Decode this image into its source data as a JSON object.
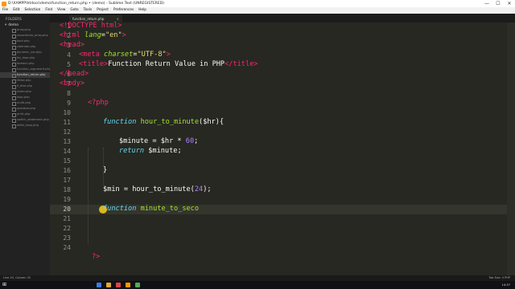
{
  "window": {
    "title": "D:\\XAMPP\\htdocs\\demo\\function_return.php • (demo) - Sublime Text (UNREGISTERED)",
    "controls": [
      "—",
      "☐",
      "✕"
    ]
  },
  "menu": [
    "File",
    "Edit",
    "Selection",
    "Find",
    "View",
    "Goto",
    "Tools",
    "Project",
    "Preferences",
    "Help"
  ],
  "sidebar": {
    "header": "FOLDERS",
    "folder": "demo",
    "files": [
      "array.php",
      "associative_array.php",
      "bool.php",
      "calendar.php",
      "dynamic_var.php",
      "for_loop.php",
      "foreach.php",
      "function_argument.php",
      "function_return.php",
      "ifelse.php",
      "if_else.php",
      "index.php",
      "loop.php",
      "multi.php",
      "operator.php",
      "print.php",
      "switch_statement.php",
      "while_loop.php"
    ],
    "active_index": 8
  },
  "tab": {
    "label": "function_return.php",
    "close": "×"
  },
  "editor": {
    "line_numbers": [
      "1",
      "2",
      "3",
      "4",
      "5",
      "6",
      "7",
      "8",
      "9",
      "10",
      "11",
      "12",
      "13",
      "14",
      "15",
      "16",
      "17",
      "18",
      "19",
      "20",
      "21",
      "22",
      "23",
      "24"
    ],
    "current_line": 20,
    "code": {
      "l1": "<!DOCTYPE html>",
      "l2_tag": "<html",
      "l2_attr": " lang",
      "l2_eq": "=",
      "l2_str": "\"en\"",
      "l2_close": ">",
      "l3": "<head>",
      "l4_tag": "<meta",
      "l4_attr": " charset",
      "l4_eq": "=",
      "l4_str": "\"UTF-8\"",
      "l4_close": ">",
      "l5_open": "<title>",
      "l5_text": "Function Return Value in PHP",
      "l5_close": "</title>",
      "l6": "</head>",
      "l7": "<body>",
      "l9": "<?php",
      "l11_kw": "function",
      "l11_fn": " hour_to_minute",
      "l11_rest": "($hr){",
      "l13_var": "$minute",
      "l13_op": " = $hr * ",
      "l13_num": "60",
      "l13_end": ";",
      "l14_kw": "return",
      "l14_rest": " $minute;",
      "l16": "}",
      "l18_var": "$min",
      "l18_op": " = hour_to_minute(",
      "l18_num": "24",
      "l18_end": ");",
      "l20_kw": "function",
      "l20_fn": " minute_to_seco",
      "l24": "?>"
    }
  },
  "statusbar": {
    "left": "Line 20, Column 32",
    "right": "Tab Size: 4    PHP"
  },
  "taskbar": {
    "time": "14:37"
  },
  "colors": {
    "editor_bg": "#272822",
    "tag": "#f92672",
    "string": "#e6db74",
    "keyword": "#66d9ef",
    "function": "#a6e22e",
    "number": "#ae81ff",
    "cursor_highlight": "#f0c419"
  }
}
